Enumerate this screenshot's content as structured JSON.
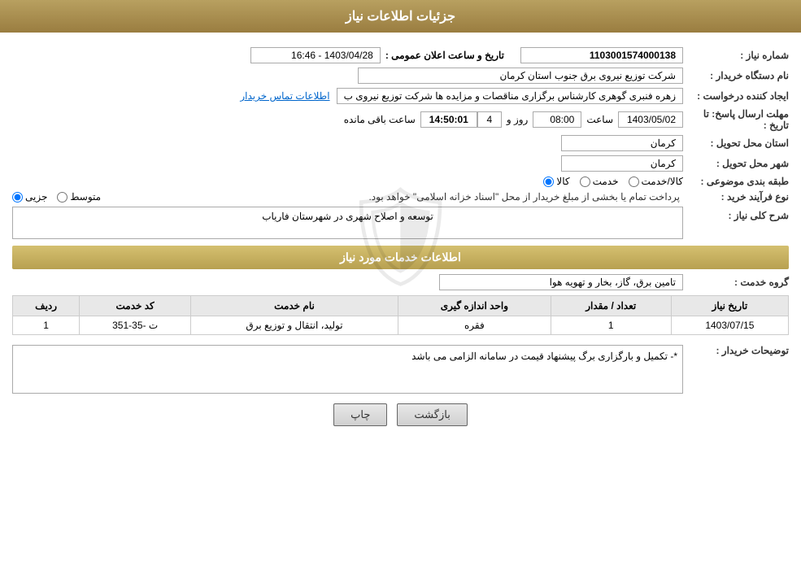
{
  "header": {
    "title": "جزئیات اطلاعات نیاز"
  },
  "fields": {
    "shomareNiaz_label": "شماره نیاز :",
    "shomareNiaz_value": "1103001574000138",
    "namDastgah_label": "نام دستگاه خریدار :",
    "namDastgah_value": "شرکت توزیع نیروی برق جنوب استان کرمان",
    "ijadKonande_label": "ایجاد کننده درخواست :",
    "ijadKonande_value": "زهره فنبری گوهری کارشناس برگزاری مناقصات و مزایده ها شرکت توزیع نیروی ب",
    "ijadKonande_link": "اطلاعات تماس خریدار",
    "mohlatErsal_label": "مهلت ارسال پاسخ: تا تاریخ :",
    "date_value": "1403/05/02",
    "saatLabel": "ساعت",
    "saat_value": "08:00",
    "roz_label": "روز و",
    "roz_value": "4",
    "countdown": "14:50:01",
    "saat_baki": "ساعت باقی مانده",
    "ostan_label": "استان محل تحویل :",
    "ostan_value": "کرمان",
    "shahr_label": "شهر محل تحویل :",
    "shahr_value": "کرمان",
    "tabaghe_label": "طبقه بندی موضوعی :",
    "radio_kala": "کالا",
    "radio_khedmat": "خدمت",
    "radio_kala_khedmat": "کالا/خدمت",
    "nove_farayand_label": "نوع فرآیند خرید :",
    "radio_jozi": "جزیی",
    "radio_mottaset": "متوسط",
    "farayand_note": "پرداخت تمام یا بخشی از مبلغ خریدار از محل \"اسناد خزانه اسلامی\" خواهد بود.",
    "sharh_label": "شرح کلی نیاز :",
    "sharh_value": "توسعه و اصلاح شهری در شهرستان فاریاب",
    "services_header": "اطلاعات خدمات مورد نیاز",
    "grohe_khedmat_label": "گروه خدمت :",
    "grohe_khedmat_value": "تامین برق، گاز، بخار و تهویه هوا",
    "table": {
      "headers": [
        "ردیف",
        "کد خدمت",
        "نام خدمت",
        "واحد اندازه گیری",
        "تعداد / مقدار",
        "تاریخ نیاز"
      ],
      "rows": [
        {
          "radif": "1",
          "kod": "ت -35-351",
          "nam": "تولید، انتقال و توزیع برق",
          "vahed": "فقره",
          "tedad": "1",
          "tarikh": "1403/07/15"
        }
      ]
    },
    "toshihat_label": "توضیحات خریدار :",
    "toshihat_value": "*- تکمیل و بارگزاری برگ پیشنهاد قیمت در سامانه الزامی می باشد",
    "tarikh_saate_elan_label": "تاریخ و ساعت اعلان عمومی :",
    "tarikh_saate_elan_value": "1403/04/28 - 16:46"
  },
  "buttons": {
    "print": "چاپ",
    "back": "بازگشت"
  }
}
